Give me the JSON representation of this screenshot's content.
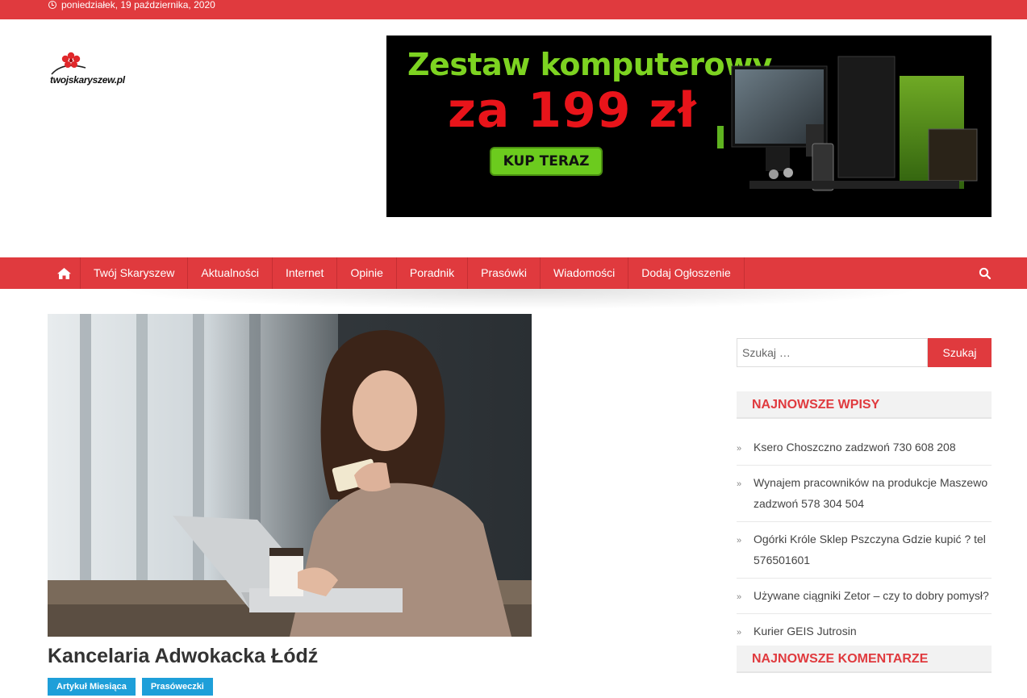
{
  "topbar": {
    "date": "poniedziałek, 19 października, 2020"
  },
  "logo": {
    "text": "twojskaryszew.pl"
  },
  "banner": {
    "title": "Zestaw komputerowy",
    "price": "za 199 zł",
    "button": "KUP TERAZ"
  },
  "nav": {
    "items": [
      "Twój Skaryszew",
      "Aktualności",
      "Internet",
      "Opinie",
      "Poradnik",
      "Prasówki",
      "Wiadomości",
      "Dodaj Ogłoszenie"
    ]
  },
  "post": {
    "title": "Kancelaria Adwokacka Łódź",
    "tags": [
      "Artykuł Miesiąca",
      "Prasóweczki"
    ]
  },
  "sidebar": {
    "search": {
      "placeholder": "Szukaj …",
      "button": "Szukaj"
    },
    "recent_heading": "NAJNOWSZE WPISY",
    "recent": [
      "Ksero Choszczno zadzwoń 730 608 208",
      "Wynajem pracowników na produkcje Maszewo zadzwoń 578 304 504",
      "Ogórki Króle Sklep Pszczyna Gdzie kupić ? tel 576501601",
      "Używane ciągniki Zetor – czy to dobry pomysł?",
      "Kurier GEIS Jutrosin"
    ],
    "comments_heading": "NAJNOWSZE KOMENTARZE"
  },
  "colors": {
    "accent": "#e03a3e",
    "tag": "#1e9fd9"
  }
}
